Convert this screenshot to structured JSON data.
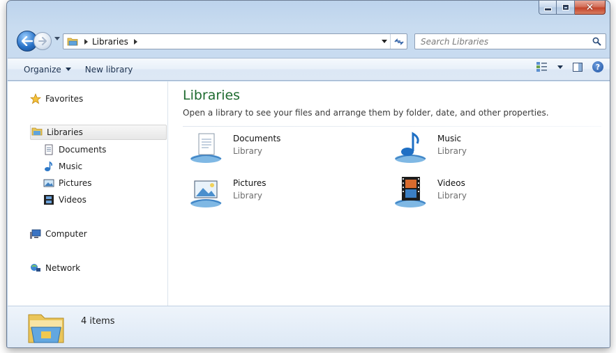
{
  "window": {
    "caption_buttons": [
      "minimize",
      "maximize",
      "close"
    ]
  },
  "address_bar": {
    "breadcrumb": [
      "Libraries"
    ],
    "search_placeholder": "Search Libraries"
  },
  "toolbar": {
    "organize_label": "Organize",
    "new_library_label": "New library"
  },
  "nav_pane": {
    "favorites": "Favorites",
    "libraries": "Libraries",
    "library_children": [
      "Documents",
      "Music",
      "Pictures",
      "Videos"
    ],
    "computer": "Computer",
    "network": "Network"
  },
  "main": {
    "heading": "Libraries",
    "subtitle": "Open a library to see your files and arrange them by folder, date, and other properties.",
    "libraries": [
      {
        "name": "Documents",
        "type": "Library",
        "icon": "documents-library-icon"
      },
      {
        "name": "Music",
        "type": "Library",
        "icon": "music-library-icon"
      },
      {
        "name": "Pictures",
        "type": "Library",
        "icon": "pictures-library-icon"
      },
      {
        "name": "Videos",
        "type": "Library",
        "icon": "videos-library-icon"
      }
    ]
  },
  "details": {
    "item_count": "4 items"
  },
  "colors": {
    "heading_green": "#1e6b2f",
    "chrome_blue": "#bcd3ec",
    "close_red": "#c4442b"
  }
}
